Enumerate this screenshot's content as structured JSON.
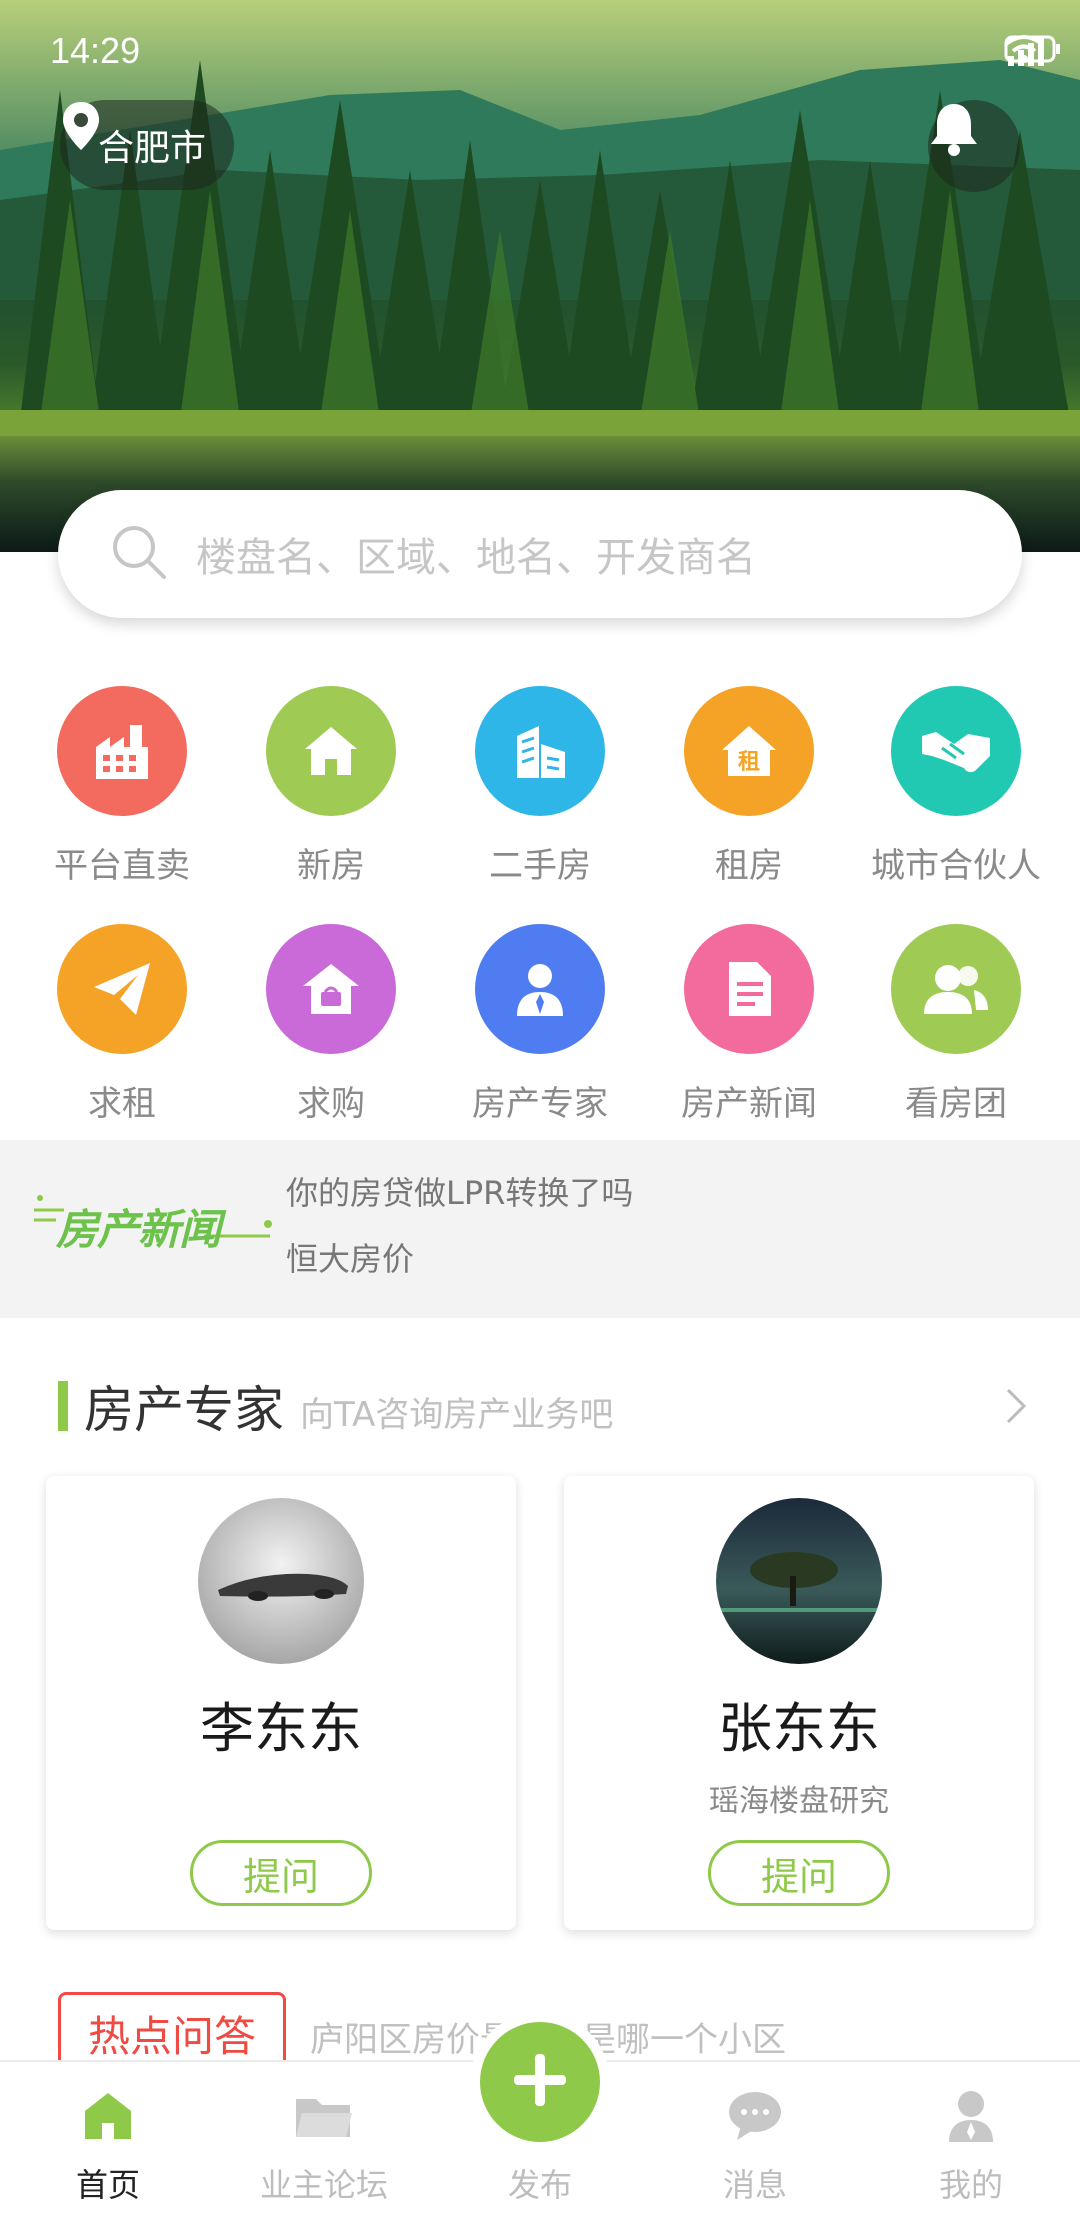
{
  "status_bar": {
    "time": "14:29",
    "network": "4G",
    "battery": "49"
  },
  "header": {
    "city": "合肥市"
  },
  "search": {
    "placeholder": "楼盘名、区域、地名、开发商名"
  },
  "categories": [
    {
      "label": "平台直卖",
      "icon": "factory-icon",
      "color": "#f36a5f"
    },
    {
      "label": "新房",
      "icon": "home-icon",
      "color": "#9fcb55"
    },
    {
      "label": "二手房",
      "icon": "buildings-icon",
      "color": "#2fb6e8"
    },
    {
      "label": "租房",
      "icon": "rent-house-icon",
      "color": "#f5a326"
    },
    {
      "label": "城市合伙人",
      "icon": "handshake-icon",
      "color": "#22c9b2"
    },
    {
      "label": "求租",
      "icon": "paper-plane-icon",
      "color": "#f5a326"
    },
    {
      "label": "求购",
      "icon": "shop-house-icon",
      "color": "#c96ad8"
    },
    {
      "label": "房产专家",
      "icon": "expert-person-icon",
      "color": "#4f7cf0"
    },
    {
      "label": "房产新闻",
      "icon": "document-icon",
      "color": "#f36a9c"
    },
    {
      "label": "看房团",
      "icon": "group-icon",
      "color": "#9fcb55"
    }
  ],
  "news": {
    "logo_text": "房产新闻",
    "items": [
      "你的房贷做LPR转换了吗",
      "恒大房价"
    ]
  },
  "experts": {
    "title": "房产专家",
    "subtitle": "向TA咨询房产业务吧",
    "cards": [
      {
        "name": "李东东",
        "desc": "",
        "button": "提问"
      },
      {
        "name": "张东东",
        "desc": "瑶海楼盘研究",
        "button": "提问"
      }
    ]
  },
  "hot_qa": {
    "tag": "热点问答",
    "text": "庐阳区房价最高的是哪一个小区"
  },
  "tabbar": {
    "tabs": [
      {
        "label": "首页",
        "icon": "home-tab-icon",
        "active": true
      },
      {
        "label": "业主论坛",
        "icon": "folder-icon",
        "active": false
      },
      {
        "label": "发布",
        "icon": "plus-icon",
        "active": false
      },
      {
        "label": "消息",
        "icon": "chat-bubble-icon",
        "active": false
      },
      {
        "label": "我的",
        "icon": "user-icon",
        "active": false
      }
    ],
    "accent": "#8fc94a"
  }
}
